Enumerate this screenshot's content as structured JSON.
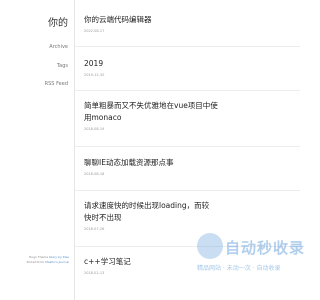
{
  "sidebar": {
    "brand": "你的",
    "nav": [
      "Archive",
      "Tags",
      "RSS Feed"
    ],
    "footer": {
      "theme_text": "Hugo Theme",
      "theme_link": "Diary by Rise",
      "ported_text": "Ported from",
      "ported_link": "Makito's Journal"
    }
  },
  "posts": [
    {
      "title": "你的云端代码编辑器",
      "date": "2022-08-17"
    },
    {
      "title": "2019",
      "date": "2019-12-30"
    },
    {
      "title": "简单粗暴而又不失优雅地在vue项目中使用monaco",
      "date": "2018-08-19"
    },
    {
      "title": "聊聊IE动态加载资源那点事",
      "date": "2018-08-18"
    },
    {
      "title": "请求速度快的时候出现loading，而较快时不出现",
      "date": "2018-07-26"
    },
    {
      "title": "c++学习笔记",
      "date": "2018-02-13"
    }
  ],
  "watermark": {
    "text": "自动秒收录",
    "subtitle": "精品网站 · 未动一次 · 自动收录",
    "color": "#64a0dc"
  }
}
